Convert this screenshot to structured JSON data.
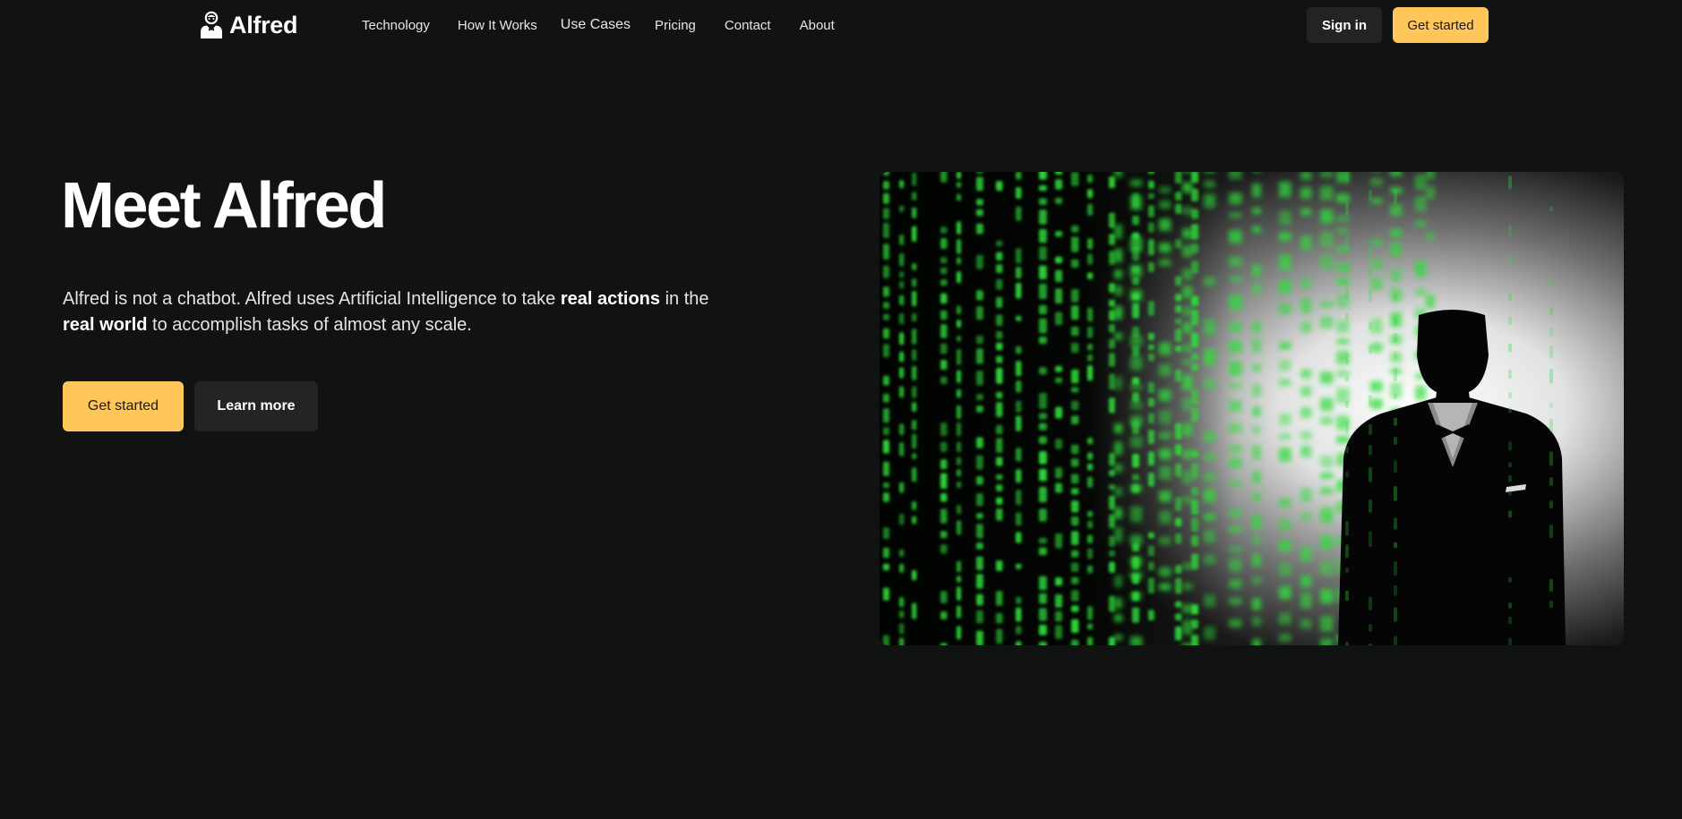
{
  "brand": {
    "name": "Alfred",
    "logo_icon": "butler-icon"
  },
  "nav": {
    "links": [
      "Technology",
      "How It Works",
      "Use Cases",
      "Pricing",
      "Contact",
      "About"
    ],
    "sign_in": "Sign in",
    "get_started": "Get started"
  },
  "hero": {
    "title": "Meet Alfred",
    "desc": {
      "t1": "Alfred is not a chatbot. Alfred uses Artificial Intelligence to take ",
      "b1": "real actions",
      "t2": " in the ",
      "b2": "real world",
      "t3": " to accomplish tasks of almost any scale."
    },
    "primary_button": "Get started",
    "secondary_button": "Learn more",
    "image": "matrix-code-butler-silhouette"
  },
  "colors": {
    "background": "#111313",
    "accent": "#ffc65a",
    "dark_button": "#222424",
    "matrix_green": "#2fdc3a"
  }
}
